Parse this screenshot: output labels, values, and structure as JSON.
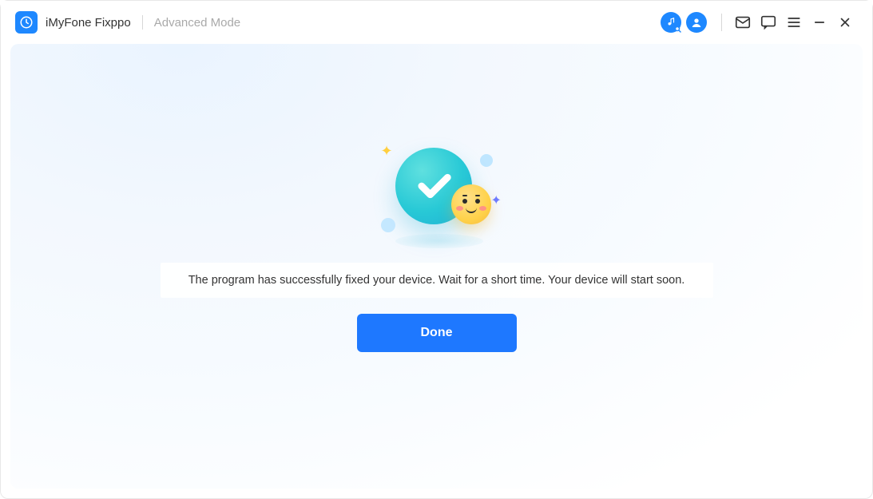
{
  "app": {
    "title": "iMyFone Fixppo",
    "mode": "Advanced Mode"
  },
  "titlebar_icons": {
    "music_search": "music-search-icon",
    "account": "account-icon",
    "mail": "mail-icon",
    "feedback": "feedback-icon",
    "menu": "menu-icon",
    "minimize": "minimize-icon",
    "close": "close-icon"
  },
  "result": {
    "message": "The program has successfully fixed your device. Wait for a short time. Your device will start soon.",
    "done_label": "Done"
  },
  "colors": {
    "primary": "#1e78ff",
    "accent_logo": "#1e88ff",
    "teal": "#28c9d6"
  }
}
